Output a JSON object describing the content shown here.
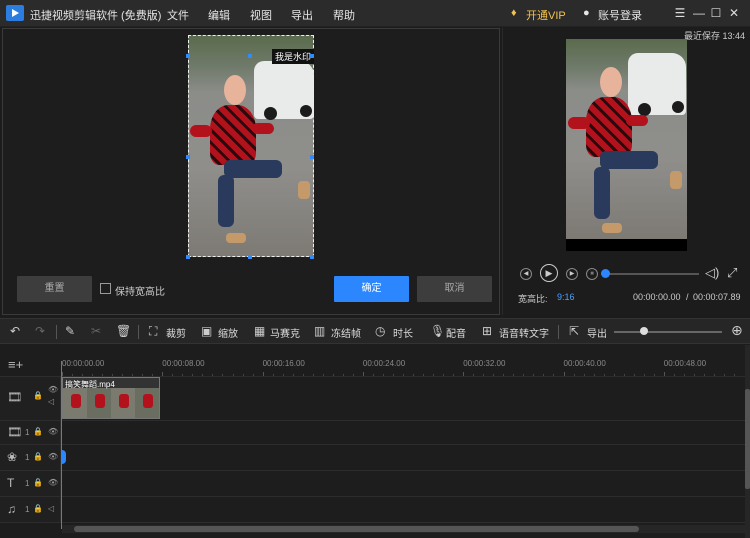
{
  "app": {
    "title": "迅捷视频剪辑软件 (免费版)"
  },
  "menu": {
    "items": [
      "文件",
      "编辑",
      "视图",
      "导出",
      "帮助"
    ]
  },
  "titlebar": {
    "vip_label": "开通VIP",
    "login_label": "账号登录",
    "colors": {
      "vip": "#f2c14e"
    }
  },
  "editor": {
    "watermark_text": "我是水印",
    "reset_label": "重置",
    "keep_ratio_label": "保持宽高比",
    "confirm_label": "确定",
    "cancel_label": "取消",
    "colors": {
      "accent": "#2c87ff"
    }
  },
  "preview": {
    "last_saved": "最近保存 13:44",
    "aspect_label": "宽高比:",
    "aspect_value": "9:16",
    "time_current": "00:00:00.00",
    "time_separator": "/",
    "time_total": "00:00:07.89",
    "progress": 0
  },
  "toolbar": {
    "crop": "裁剪",
    "zoom": "缩放",
    "mosaic": "马赛克",
    "freeze": "冻结帧",
    "duration": "时长",
    "dub": "配音",
    "speech_to_text": "语音转文字",
    "export": "导出",
    "zoom_level": 0.28
  },
  "timeline": {
    "ticks": [
      "00:00:00.00",
      "00:00:08.00",
      "00:00:16.00",
      "00:00:24.00",
      "00:00:32.00",
      "00:00:40.00",
      "00:00:48.00"
    ],
    "clip_name": "搞笑舞蹈.mp4",
    "track_numbers": [
      "1",
      "1",
      "1",
      "1"
    ]
  },
  "icons": [
    "undo-icon",
    "redo-icon",
    "edit-icon",
    "cut-icon",
    "delete-icon",
    "crop-icon",
    "zoom-icon",
    "mosaic-icon",
    "freeze-frame-icon",
    "duration-icon",
    "microphone-icon",
    "speech-to-text-icon",
    "export-icon",
    "zoom-in-icon",
    "prev-frame-icon",
    "play-icon",
    "next-frame-icon",
    "stop-icon",
    "volume-icon",
    "fullscreen-icon",
    "lock-icon",
    "eye-icon"
  ]
}
